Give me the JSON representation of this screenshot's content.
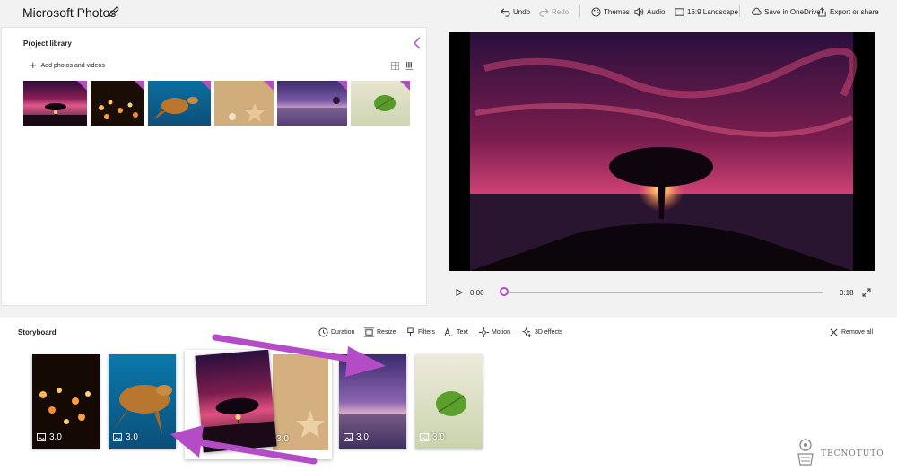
{
  "app": {
    "title": "Microsoft Photos"
  },
  "toolbar": {
    "undo": "Undo",
    "redo": "Redo",
    "themes": "Themes",
    "audio": "Audio",
    "aspect": "16:9 Landscape",
    "save_onedrive": "Save in OneDrive",
    "export": "Export or share"
  },
  "library": {
    "title": "Project library",
    "add_label": "Add photos and videos"
  },
  "player": {
    "current_time": "0:00",
    "total_time": "0:18",
    "progress": 0.0
  },
  "storyboard": {
    "title": "Storyboard",
    "tools": {
      "duration": "Duration",
      "resize": "Resize",
      "filters": "Filters",
      "text": "Text",
      "motion": "Motion",
      "effects": "3D effects",
      "remove_all": "Remove all"
    },
    "cards": [
      {
        "subject": "candles",
        "duration": "3.0"
      },
      {
        "subject": "turtle",
        "duration": "3.0"
      },
      {
        "subject": "tree-sunset",
        "duration": "3.0"
      },
      {
        "subject": "starfish",
        "duration": "3.0"
      },
      {
        "subject": "purple-sunset",
        "duration": "3.0"
      },
      {
        "subject": "leaf",
        "duration": "3.0"
      }
    ]
  },
  "watermark": {
    "text": "TECNOTUTO"
  },
  "colors": {
    "accent": "#b44cc8",
    "arrow": "#b44cc8"
  }
}
